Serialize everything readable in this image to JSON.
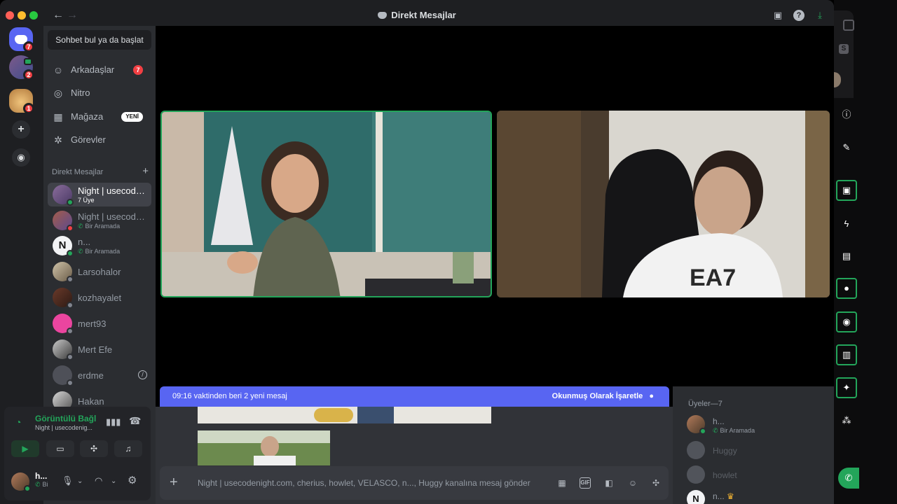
{
  "window": {
    "title": "Direkt Mesajlar"
  },
  "sidebar": {
    "search_placeholder": "Sohbet bul ya da başlat",
    "nav": [
      {
        "label": "Arkadaşlar",
        "badge": "7",
        "icon": "friends-icon"
      },
      {
        "label": "Nitro",
        "icon": "nitro-icon"
      },
      {
        "label": "Mağaza",
        "badge": "YENİ",
        "icon": "shop-icon"
      },
      {
        "label": "Görevler",
        "icon": "quests-icon"
      }
    ],
    "dm_header": "Direkt Mesajlar",
    "dms": [
      {
        "name": "Night | usecode...",
        "sub": "7 Üye"
      },
      {
        "name": "Night | usecode...",
        "sub": "Bir Aramada"
      },
      {
        "name": "n...",
        "sub": "Bir Aramada"
      },
      {
        "name": "Larsohalor"
      },
      {
        "name": "kozhayalet"
      },
      {
        "name": "mert93"
      },
      {
        "name": "Mert Efe"
      },
      {
        "name": "erdme"
      },
      {
        "name": "Hakan"
      }
    ]
  },
  "guilds": {
    "badges": [
      "7",
      "2",
      "1"
    ]
  },
  "voice": {
    "status": "Görüntülü Bağl",
    "channel": "Night | usecodenig...",
    "user_name": "h...",
    "user_sub": "Bi"
  },
  "banner": {
    "text": "09:16 vaktinden beri 2 yeni mesaj",
    "action": "Okunmuş Olarak İşaretle"
  },
  "composer": {
    "placeholder": "Night | usecodenight.com, cherius, howlet, VELASCO, n..., Huggy kanalına mesaj gönder",
    "gif_label": "GIF"
  },
  "members": {
    "header": "Üyeler—7",
    "list": [
      {
        "name": "h...",
        "sub": "Bir Aramada"
      },
      {
        "name": "Huggy"
      },
      {
        "name": "howlet"
      },
      {
        "name": "n..."
      }
    ]
  },
  "colors": {
    "accent": "#5865f2",
    "green": "#23a55a",
    "red": "#f23f43"
  }
}
